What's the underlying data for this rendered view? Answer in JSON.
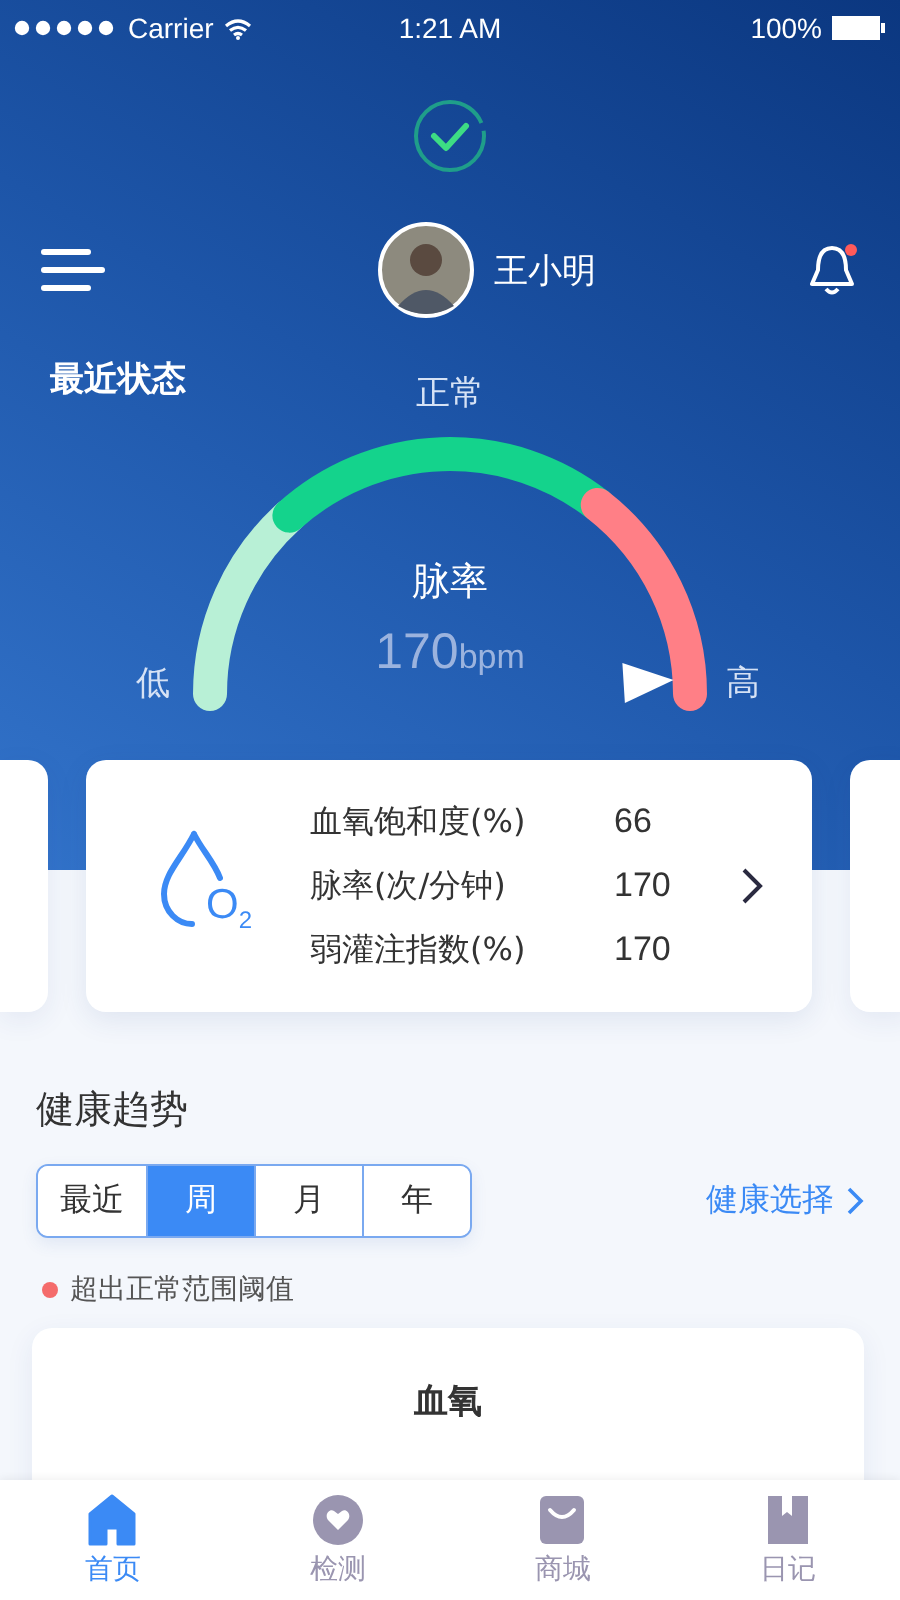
{
  "status_bar": {
    "carrier": "Carrier",
    "time": "1:21 AM",
    "battery": "100%"
  },
  "header": {
    "user_name": "王小明",
    "has_notification": true
  },
  "recent_status": {
    "title": "最近状态",
    "gauge": {
      "metric": "脉率",
      "value": "170",
      "unit": "bpm",
      "zones": [
        {
          "label": "低",
          "color": "#b8f0d6"
        },
        {
          "label": "正常",
          "color": "#14d38c"
        },
        {
          "label": "高",
          "color": "#ff7f86"
        }
      ]
    }
  },
  "summary_card": {
    "icon_text": "O$_{2}$",
    "rows": [
      {
        "label": "血氧饱和度(%)",
        "value": "66"
      },
      {
        "label": "脉率(次/分钟)",
        "value": "170"
      },
      {
        "label": "弱灌注指数(%)",
        "value": "170"
      }
    ]
  },
  "health_trend": {
    "title": "健康趋势",
    "periods": [
      {
        "label": "最近",
        "selected": false
      },
      {
        "label": "周",
        "selected": true
      },
      {
        "label": "月",
        "selected": false
      },
      {
        "label": "年",
        "selected": false
      }
    ],
    "select_link": "健康选择",
    "legend": {
      "label": "超出正常范围阈值",
      "color": "#f46b6b"
    },
    "chart_card": {
      "title": "血氧"
    }
  },
  "tab_bar": [
    {
      "label": "首页",
      "kind": "home",
      "selected": true
    },
    {
      "label": "检测",
      "kind": "heart",
      "selected": false
    },
    {
      "label": "商城",
      "kind": "bag",
      "selected": false
    },
    {
      "label": "日记",
      "kind": "book",
      "selected": false
    }
  ]
}
